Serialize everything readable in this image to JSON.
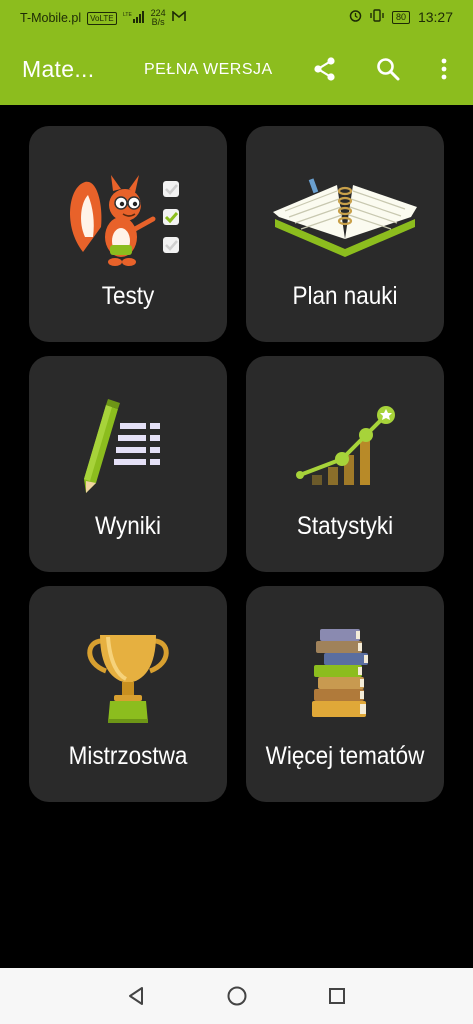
{
  "status_bar": {
    "carrier": "T-Mobile.pl",
    "volte": "VoLTE",
    "network": "LTE",
    "speed_value": "224",
    "speed_unit": "B/s",
    "battery": "80",
    "time": "13:27"
  },
  "app_bar": {
    "title": "Mate...",
    "full_version": "PEŁNA WERSJA",
    "icons": [
      "share-icon",
      "search-icon",
      "more-vertical-icon"
    ]
  },
  "colors": {
    "accent": "#8cbd1e",
    "tile_bg": "#2a2a2a",
    "background": "#000000"
  },
  "tiles": [
    {
      "label": "Testy",
      "icon": "squirrel-checklist-icon"
    },
    {
      "label": "Plan nauki",
      "icon": "planner-notebook-icon"
    },
    {
      "label": "Wyniki",
      "icon": "pencil-list-icon"
    },
    {
      "label": "Statystyki",
      "icon": "bar-chart-growth-icon"
    },
    {
      "label": "Mistrzostwa",
      "icon": "trophy-icon"
    },
    {
      "label": "Więcej tematów",
      "icon": "book-stack-icon"
    }
  ],
  "nav_bar": {
    "buttons": [
      "back-icon",
      "home-icon",
      "recents-icon"
    ]
  }
}
